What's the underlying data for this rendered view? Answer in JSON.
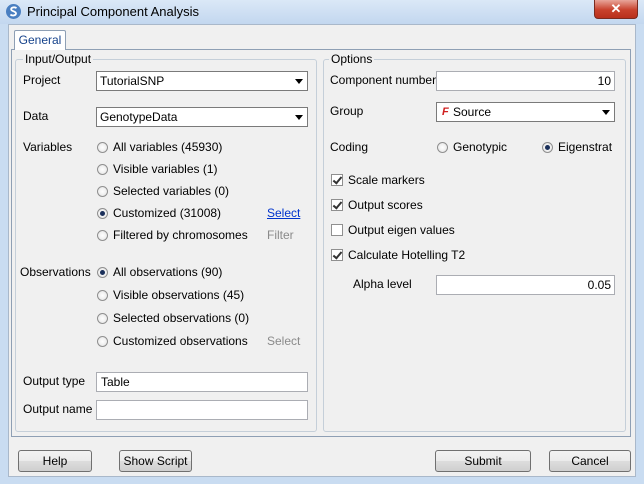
{
  "window": {
    "title": "Principal Component Analysis",
    "close_symbol": "✕"
  },
  "tabs": [
    {
      "label": "General"
    }
  ],
  "io": {
    "legend": "Input/Output",
    "project_label": "Project",
    "project_value": "TutorialSNP",
    "data_label": "Data",
    "data_value": "GenotypeData",
    "variables_label": "Variables",
    "variables_options": [
      {
        "label": "All variables (45930)",
        "selected": false
      },
      {
        "label": "Visible variables (1)",
        "selected": false
      },
      {
        "label": "Selected variables (0)",
        "selected": false
      },
      {
        "label": "Customized (31008)",
        "selected": true
      },
      {
        "label": "Filtered by chromosomes",
        "selected": false
      }
    ],
    "variables_select_link": "Select",
    "variables_filter_link": "Filter",
    "observations_label": "Observations",
    "observations_options": [
      {
        "label": "All observations (90)",
        "selected": true
      },
      {
        "label": "Visible observations (45)",
        "selected": false
      },
      {
        "label": "Selected observations (0)",
        "selected": false
      },
      {
        "label": "Customized observations",
        "selected": false
      }
    ],
    "observations_select_link": "Select",
    "output_type_label": "Output type",
    "output_type_value": "Table",
    "output_name_label": "Output name",
    "output_name_value": ""
  },
  "options": {
    "legend": "Options",
    "component_number_label": "Component number",
    "component_number_value": "10",
    "group_label": "Group",
    "group_value": "Source",
    "coding_label": "Coding",
    "coding_options": [
      {
        "label": "Genotypic",
        "selected": false
      },
      {
        "label": "Eigenstrat",
        "selected": true
      }
    ],
    "checkboxes": [
      {
        "label": "Scale markers",
        "checked": true
      },
      {
        "label": "Output scores",
        "checked": true
      },
      {
        "label": "Output eigen values",
        "checked": false
      },
      {
        "label": "Calculate Hotelling T2",
        "checked": true
      }
    ],
    "alpha_label": "Alpha level",
    "alpha_value": "0.05"
  },
  "buttons": {
    "help": "Help",
    "show_script": "Show Script",
    "submit": "Submit",
    "cancel": "Cancel"
  },
  "colors": {
    "title_bar": "#c3d7ef",
    "close": "#c8412c",
    "link": "#0033cc"
  }
}
